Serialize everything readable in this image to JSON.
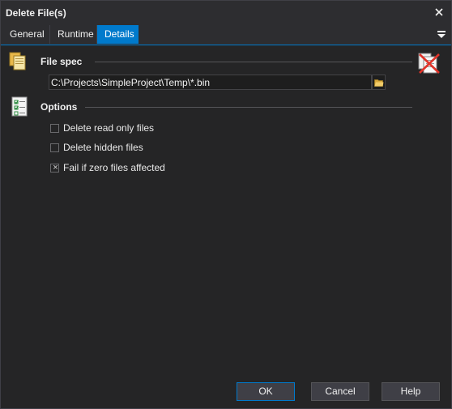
{
  "window": {
    "title": "Delete File(s)"
  },
  "tabs": [
    {
      "label": "General",
      "active": false
    },
    {
      "label": "Runtime",
      "active": false
    },
    {
      "label": "Details",
      "active": true
    }
  ],
  "file_spec": {
    "heading": "File spec",
    "path_value": "C:\\Projects\\SimpleProject\\Temp\\*.bin"
  },
  "options": {
    "heading": "Options",
    "items": [
      {
        "label": "Delete read only files",
        "checked": false
      },
      {
        "label": "Delete hidden files",
        "checked": false
      },
      {
        "label": "Fail if zero files affected",
        "checked": true
      }
    ]
  },
  "buttons": {
    "ok": "OK",
    "cancel": "Cancel",
    "help": "Help"
  },
  "icons": {
    "close": "close-icon",
    "tab_menu": "menu-icon",
    "file_spec": "files-icon",
    "options": "checklist-icon",
    "browse": "folder-open-icon",
    "delete": "delete-files-icon"
  },
  "colors": {
    "accent": "#007acc",
    "background": "#252526",
    "titlebar": "#2d2d30"
  }
}
